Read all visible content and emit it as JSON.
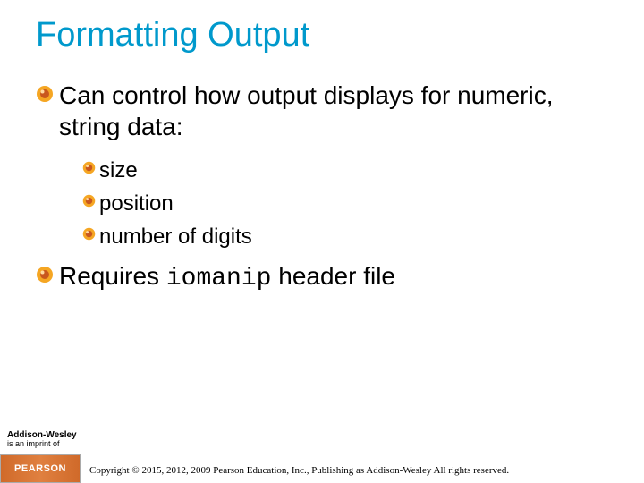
{
  "title": "Formatting Output",
  "bullets": {
    "b1": "Can control how output displays for numeric, string data:",
    "b1a": "size",
    "b1b": "position",
    "b1c": "number of digits",
    "b2_pre": "Requires ",
    "b2_code": "iomanip",
    "b2_post": " header file"
  },
  "footer": {
    "brand": "Addison-Wesley",
    "imprint_line": "is an imprint of",
    "pearson": "PEARSON",
    "copyright": "Copyright © 2015, 2012, 2009 Pearson Education, Inc., Publishing as Addison-Wesley All rights reserved."
  }
}
